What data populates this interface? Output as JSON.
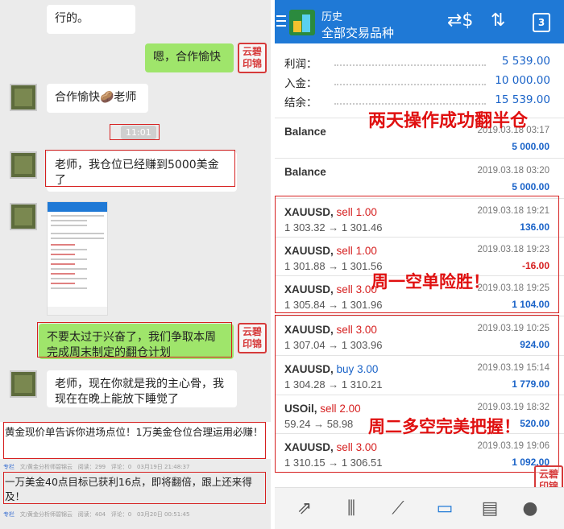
{
  "chat": {
    "msg_top": "行的。",
    "msg_me_1": "嗯，合作愉快",
    "msg_teacher_1": "合作愉快🥔老师",
    "time_chip": "11:01",
    "msg_user_2": "老师，我仓位已经赚到5000美金了",
    "msg_me_2": "不要太过于兴奋了，我们争取本周完成周末制定的翻仓计划",
    "msg_user_3": "老师，现在你就是我的主心骨，我现在在晚上能放下睡觉了",
    "stamp_text": "云碧印锦"
  },
  "articles": [
    {
      "text": "黄金现价单告诉你进场点位！1万美金仓位合理运用必赚！",
      "meta_tag": "专栏",
      "meta_author": "文/黄金分析师碧锦云",
      "meta_reads": "阅读：299",
      "meta_comments": "评论：0",
      "meta_date": "03月19日 21:48:37"
    },
    {
      "text": "一万美金40点目标已获利16点，即将翻倍，跟上还来得及！",
      "meta_tag": "专栏",
      "meta_author": "文/黄金分析师碧锦云",
      "meta_reads": "阅读：404",
      "meta_comments": "评论：0",
      "meta_date": "03月20日 00:51:45"
    }
  ],
  "app": {
    "title": "历史",
    "subtitle": "全部交易品种",
    "calendar_day": "3",
    "summary": [
      {
        "label": "利润：",
        "value": "5 539.00"
      },
      {
        "label": "入金：",
        "value": "10 000.00"
      },
      {
        "label": "结余：",
        "value": "15 539.00"
      }
    ],
    "balance_rows": [
      {
        "name": "Balance",
        "date": "2019.03.18 03:17",
        "amount": "5 000.00"
      },
      {
        "name": "Balance",
        "date": "2019.03.18 03:20",
        "amount": "5 000.00"
      }
    ],
    "trades": [
      {
        "symbol": "XAUUSD,",
        "type": "sell",
        "lots": "1.00",
        "prices": "1 303.32 → 1 301.46",
        "date": "2019.03.18 19:21",
        "profit": "136.00",
        "sign": "pos"
      },
      {
        "symbol": "XAUUSD,",
        "type": "sell",
        "lots": "1.00",
        "prices": "1 301.88 → 1 301.56",
        "date": "2019.03.18 19:23",
        "profit": "-16.00",
        "sign": "neg"
      },
      {
        "symbol": "XAUUSD,",
        "type": "sell",
        "lots": "3.00",
        "prices": "1 305.84 → 1 301.96",
        "date": "2019.03.18 19:25",
        "profit": "1 104.00",
        "sign": "pos"
      },
      {
        "symbol": "XAUUSD,",
        "type": "sell",
        "lots": "3.00",
        "prices": "1 307.04 → 1 303.96",
        "date": "2019.03.19 10:25",
        "profit": "924.00",
        "sign": "pos"
      },
      {
        "symbol": "XAUUSD,",
        "type": "buy",
        "lots": "3.00",
        "prices": "1 304.28 → 1 310.21",
        "date": "2019.03.19 15:14",
        "profit": "1 779.00",
        "sign": "pos"
      },
      {
        "symbol": "USOil,",
        "type": "sell",
        "lots": "2.00",
        "prices": "59.24 → 58.98",
        "date": "2019.03.19 18:32",
        "profit": "520.00",
        "sign": "pos"
      },
      {
        "symbol": "XAUUSD,",
        "type": "sell",
        "lots": "3.00",
        "prices": "1 310.15 → 1 306.51",
        "date": "2019.03.19 19:06",
        "profit": "1 092.00",
        "sign": "pos"
      }
    ],
    "overlays": {
      "headline": "两天操作成功翻半仓",
      "monday": "周一空单险胜！",
      "tuesday": "周二多空完美把握！"
    },
    "nav": [
      {
        "icon": "trade-icon"
      },
      {
        "icon": "candles-icon"
      },
      {
        "icon": "chart-icon"
      },
      {
        "icon": "history-inbox-icon"
      },
      {
        "icon": "news-icon"
      },
      {
        "icon": "messages-icon"
      }
    ]
  }
}
